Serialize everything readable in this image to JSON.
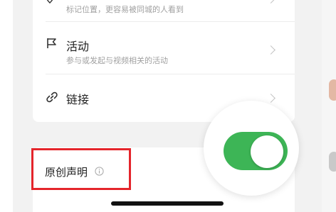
{
  "location_row": {
    "subtitle": "标记位置，更容易被同城的人看到"
  },
  "activity_row": {
    "title": "活动",
    "subtitle": "参与或发起与视频相关的活动"
  },
  "link_row": {
    "title": "链接"
  },
  "original_row": {
    "title": "原创声明",
    "info_icon": "info-circle-icon"
  },
  "toggle": {
    "state": "on",
    "color": "#3db556"
  },
  "highlight": {
    "color": "#e4252b"
  }
}
